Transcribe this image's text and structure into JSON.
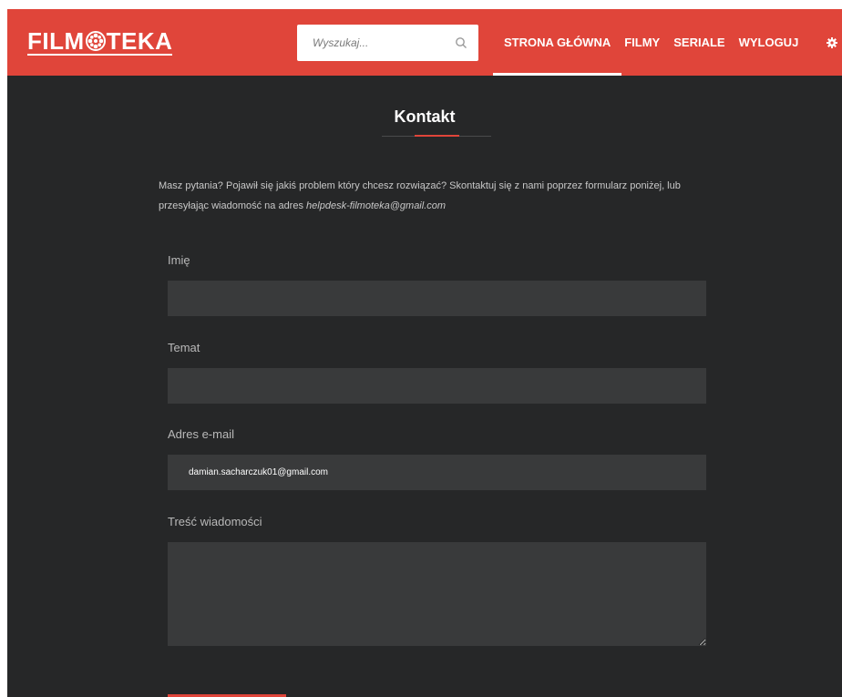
{
  "header": {
    "logo": "FILMOTEKA",
    "logo_left": "FILM",
    "logo_right": "TEKA",
    "search_placeholder": "Wyszukaj...",
    "nav": [
      {
        "label": "STRONA GŁÓWNA",
        "active": true
      },
      {
        "label": "FILMY",
        "active": false
      },
      {
        "label": "SERIALE",
        "active": false
      },
      {
        "label": "WYLOGUJ",
        "active": false
      }
    ],
    "settings_icon": "gear-icon"
  },
  "main": {
    "title": "Kontakt",
    "intro_text": "Masz pytania? Pojawił się jakiś problem który chcesz rozwiązać? Skontaktuj się z nami poprzez formularz poniżej, lub przesyłając wiadomość na adres ",
    "intro_email": "helpdesk-filmoteka@gmail.com",
    "form": {
      "name_label": "Imię",
      "name_value": "",
      "subject_label": "Temat",
      "subject_value": "",
      "email_label": "Adres e-mail",
      "email_value": "damian.sacharczuk01@gmail.com",
      "message_label": "Treść wiadomości",
      "message_value": ""
    }
  },
  "colors": {
    "accent": "#e0453a",
    "background": "#262728",
    "field": "#393a3b"
  }
}
